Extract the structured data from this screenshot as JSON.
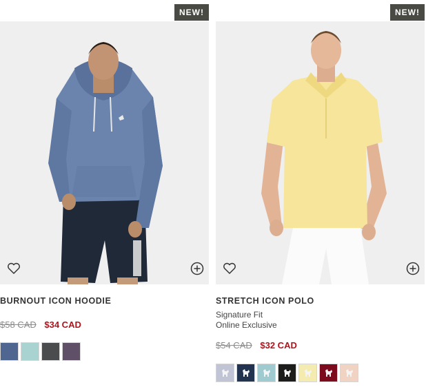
{
  "products": [
    {
      "badge": "NEW!",
      "name": "BURNOUT ICON HOODIE",
      "fit": "",
      "tag": "",
      "price_old": "$58 CAD",
      "price_new": "$34 CAD",
      "accent_sale": "#b0131c",
      "swatches": [
        "#4f6690",
        "#a8d3d0",
        "#4a4c4e",
        "#5f5068"
      ]
    },
    {
      "badge": "NEW!",
      "name": "STRETCH ICON POLO",
      "fit": "Signature Fit",
      "tag": "Online Exclusive",
      "price_old": "$54 CAD",
      "price_new": "$32 CAD",
      "accent_sale": "#b0131c",
      "swatches": [
        "#c0c4d4",
        "#22334f",
        "#9fcad0",
        "#1d1d1c",
        "#f4ebb0",
        "#7c0c1d",
        "#f1d3c3"
      ]
    }
  ],
  "icons": {
    "favorite": "heart-outline-icon",
    "add": "plus-circle-icon"
  }
}
